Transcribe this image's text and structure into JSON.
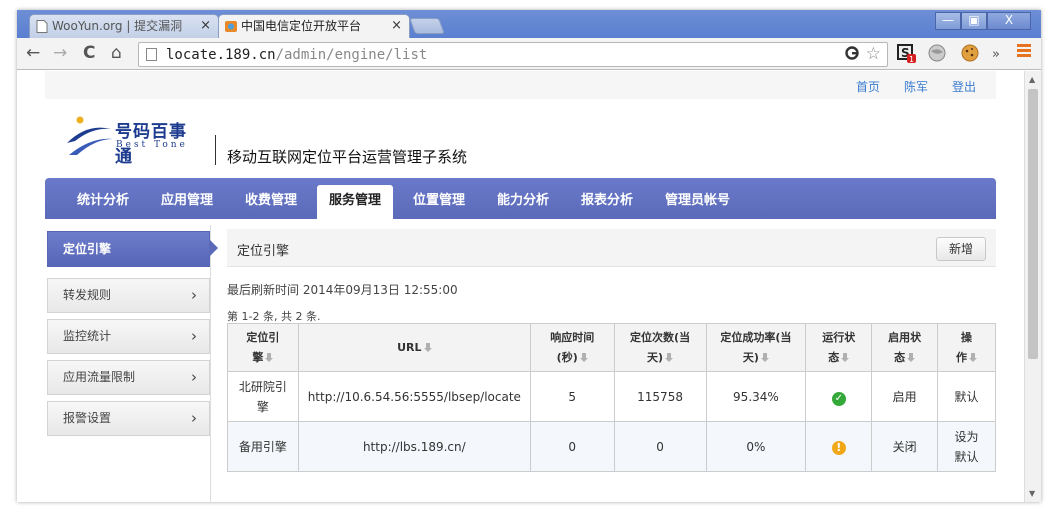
{
  "browser": {
    "tabs": [
      {
        "title": "WooYun.org | 提交漏洞"
      },
      {
        "title": "中国电信定位开放平台"
      }
    ],
    "tab_close": "×",
    "window_buttons": {
      "minimize": "—",
      "maximize": "▣",
      "close": "X"
    },
    "nav": {
      "back": "←",
      "forward": "→",
      "reload": "C",
      "home": "⌂"
    },
    "address": {
      "host": "locate.189.cn",
      "path": "/admin/engine/list"
    },
    "extension_badge": "1",
    "overflow": "»"
  },
  "top_links": [
    "首页",
    "陈军",
    "登出"
  ],
  "logo": {
    "cn": "号码百事通",
    "en": "Best Tone"
  },
  "system_title": "移动互联网定位平台运营管理子系统",
  "main_nav": [
    {
      "label": "统计分析"
    },
    {
      "label": "应用管理"
    },
    {
      "label": "收费管理"
    },
    {
      "label": "服务管理",
      "active": true
    },
    {
      "label": "位置管理"
    },
    {
      "label": "能力分析"
    },
    {
      "label": "报表分析"
    },
    {
      "label": "管理员帐号"
    }
  ],
  "sidebar": [
    {
      "label": "定位引擎",
      "active": true
    },
    {
      "label": "转发规则"
    },
    {
      "label": "监控统计"
    },
    {
      "label": "应用流量限制"
    },
    {
      "label": "报警设置"
    }
  ],
  "chevron": "›",
  "content": {
    "title": "定位引擎",
    "add_button": "新增",
    "refresh_text": "最后刷新时间 2014年09月13日 12:55:00",
    "count_text": "第 1-2 条, 共 2 条."
  },
  "table": {
    "headers": {
      "engine": [
        "定位引",
        "擎"
      ],
      "url": "URL",
      "resp": [
        "响应时间",
        "(秒)"
      ],
      "count": [
        "定位次数(当",
        "天)"
      ],
      "rate": [
        "定位成功率(当",
        "天)"
      ],
      "run": [
        "运行状",
        "态"
      ],
      "enabled": [
        "启用状",
        "态"
      ],
      "op": [
        "操",
        "作"
      ]
    },
    "rows": [
      {
        "engine": [
          "北研院引",
          "擎"
        ],
        "url": "http://10.6.54.56:5555/lbsep/locate",
        "resp": "5",
        "count": "115758",
        "rate": "95.34%",
        "enabled": "启用",
        "op": [
          "默认"
        ],
        "status_icon": "ok",
        "status_color": "#35a83a"
      },
      {
        "engine": [
          "备用引擎"
        ],
        "url": "http://lbs.189.cn/",
        "resp": "0",
        "count": "0",
        "rate": "0%",
        "enabled": "关闭",
        "op": [
          "设为",
          "默认"
        ],
        "status_icon": "warning",
        "status_color": "#f0a818"
      }
    ]
  }
}
